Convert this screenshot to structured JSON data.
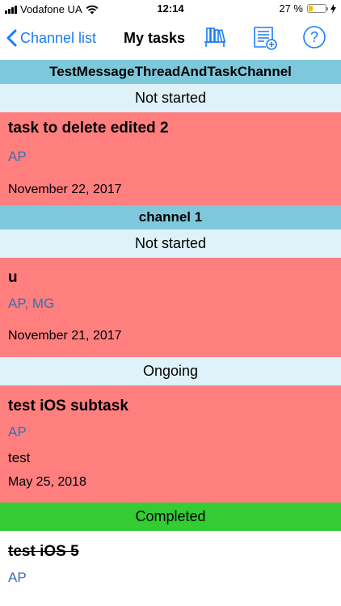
{
  "status_bar": {
    "carrier": "Vodafone UA",
    "time": "12:14",
    "battery_pct": "27 %",
    "battery_level": 0.27
  },
  "nav": {
    "back_label": "Channel list",
    "title": "My tasks",
    "icons": [
      "books-icon",
      "add-task-icon",
      "help-icon"
    ]
  },
  "colors": {
    "accent": "#1a7cf5",
    "channel_header": "#7ec8dc",
    "status_header": "#dff2fa",
    "overdue_task": "#ff7f7f",
    "completed_header": "#33cc33",
    "assignee": "#3a6fb0"
  },
  "channels": [
    {
      "name": "TestMessageThreadAndTaskChannel",
      "groups": [
        {
          "status": "Not started",
          "tasks": [
            {
              "title": "task to delete edited 2",
              "assignees": "AP",
              "date": "November 22, 2017"
            }
          ]
        }
      ]
    },
    {
      "name": "channel 1",
      "groups": [
        {
          "status": "Not started",
          "tasks": [
            {
              "title": "u",
              "assignees": "AP, MG",
              "date": "November 21, 2017"
            }
          ]
        },
        {
          "status": "Ongoing",
          "tasks": [
            {
              "title": "test iOS subtask",
              "assignees": "AP",
              "description": "test",
              "date": "May 25, 2018"
            }
          ]
        },
        {
          "status": "Completed",
          "tasks": [
            {
              "title": "test iOS 5",
              "assignees": "AP"
            }
          ]
        }
      ]
    }
  ]
}
